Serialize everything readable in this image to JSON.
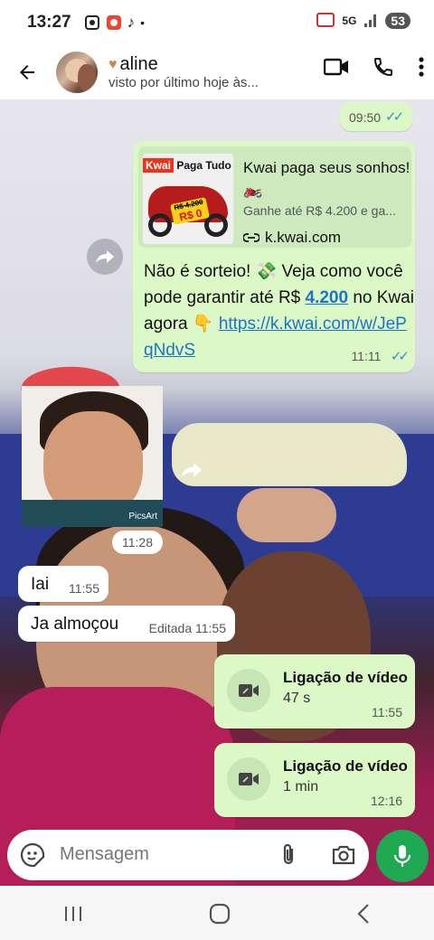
{
  "status_bar": {
    "time": "13:27",
    "battery": "53"
  },
  "header": {
    "name": "aline",
    "status": "visto por último hoje às..."
  },
  "messages": {
    "out_time_0950": "09:50",
    "promo": {
      "thumb_brand": "Kwai",
      "thumb_text": "Paga Tudo",
      "thumb_price": "R$ 4.200",
      "thumb_price2": "R$ 0",
      "link_title": "Kwai paga seus sonhos! 🏍️",
      "link_desc": "Ganhe até R$ 4.200 e ga...",
      "link_domain": "k.kwai.com",
      "text_1": "Não é sorteio! 💸 Veja como você pode garantir até R$ ",
      "text_amount": "4.200",
      "text_2": " no Kwai agora 👇 ",
      "text_url": "https://k.kwai.com/w/JePqNdvS",
      "time": "11:11"
    },
    "sticker_label": "PicsArt",
    "sticker_time": "11:28",
    "in_1": {
      "text": "Iai",
      "time": "11:55"
    },
    "in_2": {
      "text": "Ja almoçou",
      "time": "Editada 11:55"
    },
    "call_1": {
      "title": "Ligação de vídeo",
      "duration": "47 s",
      "time": "11:55"
    },
    "call_2": {
      "title": "Ligação de vídeo",
      "duration": "1 min",
      "time": "12:16"
    }
  },
  "composer": {
    "placeholder": "Mensagem"
  },
  "colors": {
    "outgoing": "#dcf8c6",
    "accent": "#1ea952",
    "link": "#1b74c7"
  },
  "icons": [
    "back-arrow-icon",
    "video-call-icon",
    "phone-icon",
    "more-vert-icon",
    "forward-icon",
    "video-camera-icon",
    "sticker-icon",
    "attach-icon",
    "camera-icon",
    "mic-icon"
  ]
}
